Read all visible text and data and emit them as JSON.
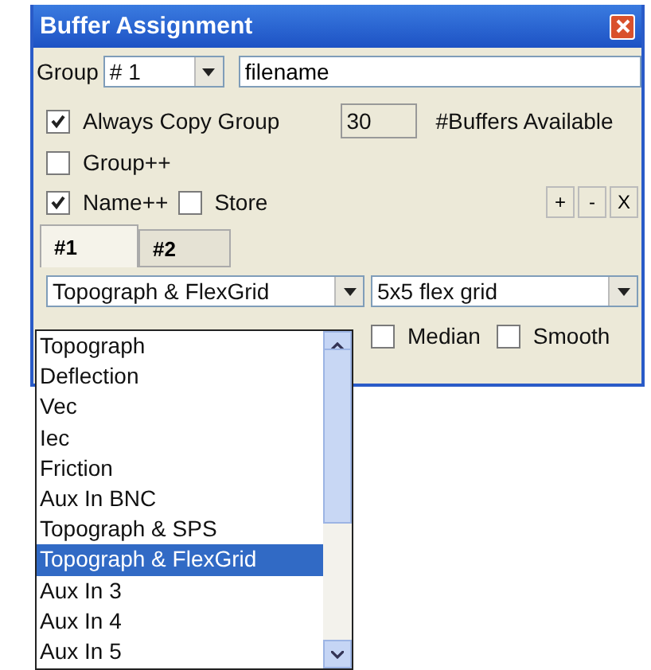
{
  "window": {
    "title": "Buffer Assignment"
  },
  "group": {
    "label": "Group",
    "value": "# 1",
    "filename": "filename"
  },
  "options": [
    {
      "label": "Always Copy Group",
      "checked": true
    },
    {
      "label": "Group++",
      "checked": false
    },
    {
      "label": "Name++",
      "checked": true
    },
    {
      "label": "Store",
      "checked": false
    }
  ],
  "buffers": {
    "value": "30",
    "label": "#Buffers Available"
  },
  "buttons": [
    "+",
    "-",
    "X"
  ],
  "tabs": [
    {
      "label": "#1",
      "selected": true
    },
    {
      "label": "#2",
      "selected": false
    }
  ],
  "mode_combo": {
    "value": "Topograph & FlexGrid"
  },
  "grid_combo": {
    "value": "5x5 flex grid"
  },
  "filters": [
    {
      "label": "Median",
      "checked": false
    },
    {
      "label": "Smooth",
      "checked": false
    }
  ],
  "mode_list": [
    {
      "label": "Topograph",
      "selected": false
    },
    {
      "label": "Deflection",
      "selected": false
    },
    {
      "label": "Vec",
      "selected": false
    },
    {
      "label": "Iec",
      "selected": false
    },
    {
      "label": "Friction",
      "selected": false
    },
    {
      "label": "Aux In BNC",
      "selected": false
    },
    {
      "label": "Topograph & SPS",
      "selected": false
    },
    {
      "label": "Topograph & FlexGrid",
      "selected": true
    },
    {
      "label": "Aux In 3",
      "selected": false
    },
    {
      "label": "Aux In 4",
      "selected": false
    },
    {
      "label": "Aux In 5",
      "selected": false
    }
  ]
}
